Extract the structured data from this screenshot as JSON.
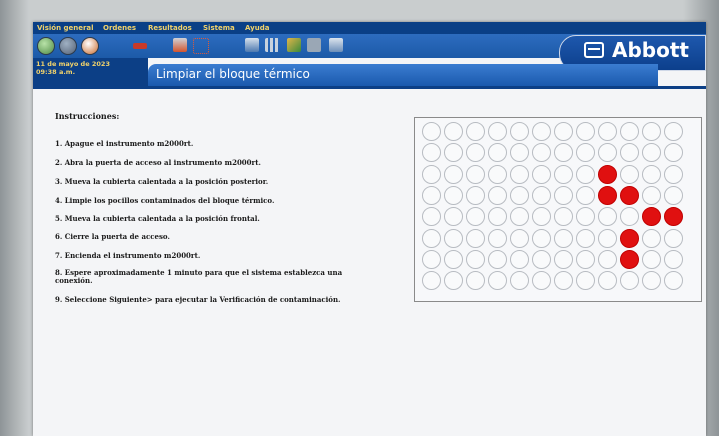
{
  "menu": [
    "Visión general",
    "Ordenes",
    "Resultados",
    "Sistema",
    "Ayuda"
  ],
  "header": {
    "date": "11 de mayo de 2023",
    "time": "09:38 a.m.",
    "brand": "Abbott"
  },
  "page": {
    "title": "Limpiar el bloque térmico"
  },
  "instructions": {
    "heading": "Instrucciones:",
    "steps": [
      "1.  Apague el instrumento m2000rt.",
      "2.  Abra la puerta de acceso al instrumento m2000rt.",
      "3.  Mueva la cubierta calentada a la posición posterior.",
      "4.  Limpie los pocillos contaminados del bloque térmico.",
      "5.  Mueva la cubierta calentada a la posición frontal.",
      "6.  Cierre la puerta de acceso.",
      "7.  Encienda el instrumento m2000rt.",
      "8.  Espere aproximadamente 1 minuto para que el sistema establezca una conexión.",
      "9.  Seleccione Siguiente> para ejecutar la Verificación de contaminación."
    ]
  },
  "plate": {
    "rows": 8,
    "cols": 12,
    "contaminated_wells": [
      [
        2,
        8
      ],
      [
        3,
        8
      ],
      [
        3,
        9
      ],
      [
        4,
        10
      ],
      [
        4,
        11
      ],
      [
        5,
        9
      ],
      [
        6,
        9
      ]
    ],
    "colors": {
      "contaminated": "#e01010",
      "empty": "#f9fafb"
    }
  },
  "colors": {
    "menubar": "#0a3f86",
    "menu_text": "#f2d36b",
    "titlebar": "#1a59ad"
  }
}
